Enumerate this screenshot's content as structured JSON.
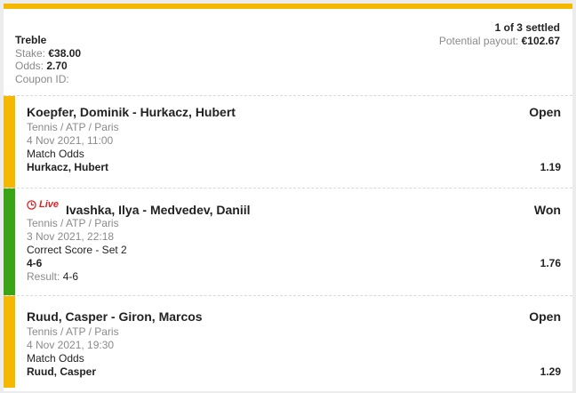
{
  "summary": {
    "bet_type": "Treble",
    "stake_label": "Stake:",
    "stake_value": "€38.00",
    "odds_label": "Odds:",
    "odds_value": "2.70",
    "coupon_label": "Coupon ID:",
    "settled_text": "1 of 3 settled",
    "payout_label": "Potential payout:",
    "payout_value": "€102.67"
  },
  "colors": {
    "accent": "#f5b800",
    "open": "#f5b800",
    "won": "#3aa316",
    "live": "#e02020"
  },
  "legs": [
    {
      "event": "Koepfer, Dominik - Hurkacz, Hubert",
      "status": "Open",
      "category": "Tennis / ATP / Paris",
      "datetime": "4 Nov 2021, 11:00",
      "market": "Match Odds",
      "selection": "Hurkacz, Hubert",
      "odds": "1.19"
    },
    {
      "live_label": "Live",
      "live_icon": "clock-icon",
      "event": "Ivashka, Ilya - Medvedev, Daniil",
      "status": "Won",
      "category": "Tennis / ATP / Paris",
      "datetime": "3 Nov 2021, 22:18",
      "market": "Correct Score - Set 2",
      "selection": "4-6",
      "odds": "1.76",
      "result_label": "Result:",
      "result_value": "4-6"
    },
    {
      "event": "Ruud, Casper - Giron, Marcos",
      "status": "Open",
      "category": "Tennis / ATP / Paris",
      "datetime": "4 Nov 2021, 19:30",
      "market": "Match Odds",
      "selection": "Ruud, Casper",
      "odds": "1.29"
    }
  ]
}
